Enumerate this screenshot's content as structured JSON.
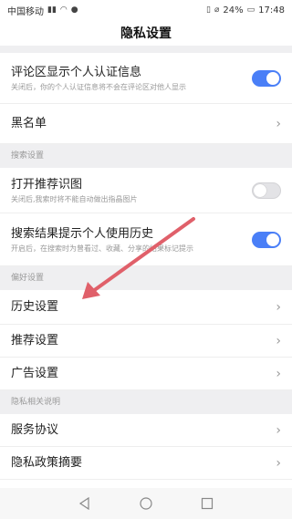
{
  "status": {
    "carrier": "中国移动",
    "battery": "24%",
    "time": "17:48"
  },
  "header": {
    "title": "隐私设置"
  },
  "section1": {
    "items": [
      {
        "title": "评论区显示个人认证信息",
        "desc": "关闭后，你的个人认证信息将不会在评论区对他人显示",
        "toggle": "on"
      },
      {
        "title": "黑名单"
      }
    ]
  },
  "group_search": {
    "header": "搜索设置"
  },
  "search": {
    "items": [
      {
        "title": "打开推荐识图",
        "desc": "关闭后,我索时将不能自动做出指晶图片",
        "toggle": "off"
      },
      {
        "title": "搜索结果提示个人使用历史",
        "desc": "开启后，在搜索时为曾看过、收藏、分享的结果标记提示",
        "toggle": "on"
      }
    ]
  },
  "group_pref": {
    "header": "偏好设置"
  },
  "pref": {
    "items": [
      {
        "title": "历史设置"
      },
      {
        "title": "推荐设置"
      },
      {
        "title": "广告设置"
      }
    ]
  },
  "group_privacy": {
    "header": "隐私相关说明"
  },
  "privacy": {
    "items": [
      {
        "title": "服务协议"
      },
      {
        "title": "隐私政策摘要"
      }
    ]
  },
  "colors": {
    "toggle_on": "#4a7ff7",
    "annotation_arrow": "#e0606a"
  },
  "icons": {
    "chevron": "›",
    "back": "‹"
  }
}
